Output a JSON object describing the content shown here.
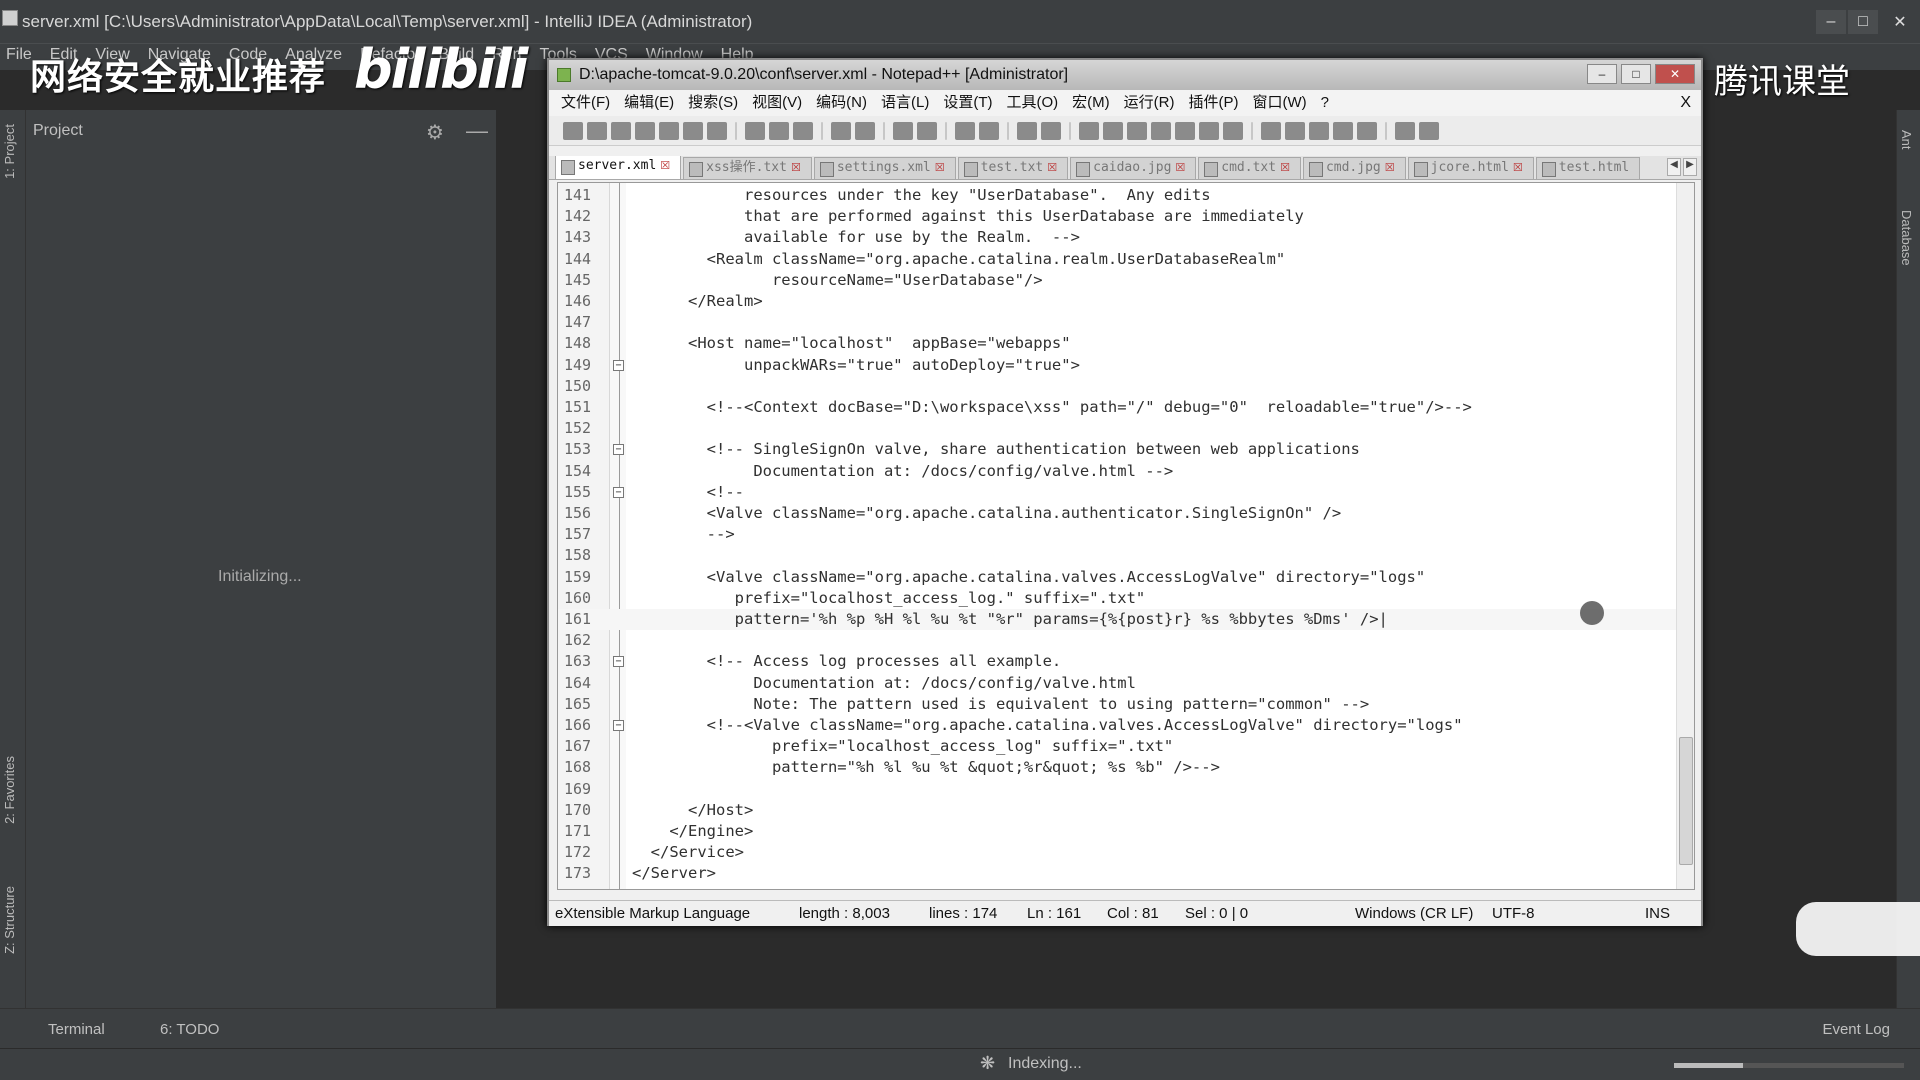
{
  "ide": {
    "title": "server.xml [C:\\Users\\Administrator\\AppData\\Local\\Temp\\server.xml] - IntelliJ IDEA (Administrator)",
    "menu": [
      "File",
      "Edit",
      "View",
      "Navigate",
      "Code",
      "Analyze",
      "Refactor",
      "Build",
      "Run",
      "Tools",
      "VCS",
      "Window",
      "Help"
    ],
    "project_panel": {
      "title": "Project",
      "status": "Initializing..."
    },
    "left_tabs": [
      "1: Project",
      "2: Favorites",
      "Z: Structure"
    ],
    "right_tabs": [
      "Ant",
      "Database"
    ],
    "bottom_tabs": {
      "terminal": "Terminal",
      "todo": "6: TODO",
      "event_log": "Event Log"
    },
    "status": {
      "indexing": "Indexing...",
      "progress": 0.3
    }
  },
  "watermarks": {
    "left": "网络安全就业推荐",
    "logo": "bilibili",
    "right": "腾讯课堂"
  },
  "npp": {
    "title": "D:\\apache-tomcat-9.0.20\\conf\\server.xml - Notepad++ [Administrator]",
    "menu": [
      "文件(F)",
      "编辑(E)",
      "搜索(S)",
      "视图(V)",
      "编码(N)",
      "语言(L)",
      "设置(T)",
      "工具(O)",
      "宏(M)",
      "运行(R)",
      "插件(P)",
      "窗口(W)",
      "?"
    ],
    "menu_close": "X",
    "tabs": [
      "server.xml",
      "xss操作.txt",
      "settings.xml",
      "test.txt",
      "caidao.jpg",
      "cmd.txt",
      "cmd.jpg",
      "jcore.html",
      "test.html"
    ],
    "active_tab": 0,
    "code_lines": [
      {
        "n": "141",
        "t": "            resources under the key \"UserDatabase\".  Any edits"
      },
      {
        "n": "142",
        "t": "            that are performed against this UserDatabase are immediately"
      },
      {
        "n": "143",
        "t": "            available for use by the Realm.  -->"
      },
      {
        "n": "144",
        "t": "        <Realm className=\"org.apache.catalina.realm.UserDatabaseRealm\""
      },
      {
        "n": "145",
        "t": "               resourceName=\"UserDatabase\"/>"
      },
      {
        "n": "146",
        "t": "      </Realm>"
      },
      {
        "n": "147",
        "t": ""
      },
      {
        "n": "148",
        "t": "      <Host name=\"localhost\"  appBase=\"webapps\""
      },
      {
        "n": "149",
        "t": "            unpackWARs=\"true\" autoDeploy=\"true\">"
      },
      {
        "n": "150",
        "t": ""
      },
      {
        "n": "151",
        "t": "        <!--<Context docBase=\"D:\\workspace\\xss\" path=\"/\" debug=\"0\"  reloadable=\"true\"/>-->"
      },
      {
        "n": "152",
        "t": ""
      },
      {
        "n": "153",
        "t": "        <!-- SingleSignOn valve, share authentication between web applications"
      },
      {
        "n": "154",
        "t": "             Documentation at: /docs/config/valve.html -->"
      },
      {
        "n": "155",
        "t": "        <!--"
      },
      {
        "n": "156",
        "t": "        <Valve className=\"org.apache.catalina.authenticator.SingleSignOn\" />"
      },
      {
        "n": "157",
        "t": "        -->"
      },
      {
        "n": "158",
        "t": ""
      },
      {
        "n": "159",
        "t": "        <Valve className=\"org.apache.catalina.valves.AccessLogValve\" directory=\"logs\""
      },
      {
        "n": "160",
        "t": "           prefix=\"localhost_access_log.\" suffix=\".txt\""
      },
      {
        "n": "161",
        "t": "           pattern='%h %p %H %l %u %t \"%r\" params={%{post}r} %s %bbytes %Dms' />|"
      },
      {
        "n": "162",
        "t": ""
      },
      {
        "n": "163",
        "t": "        <!-- Access log processes all example."
      },
      {
        "n": "164",
        "t": "             Documentation at: /docs/config/valve.html"
      },
      {
        "n": "165",
        "t": "             Note: The pattern used is equivalent to using pattern=\"common\" -->"
      },
      {
        "n": "166",
        "t": "        <!--<Valve className=\"org.apache.catalina.valves.AccessLogValve\" directory=\"logs\""
      },
      {
        "n": "167",
        "t": "               prefix=\"localhost_access_log\" suffix=\".txt\""
      },
      {
        "n": "168",
        "t": "               pattern=\"%h %l %u %t &quot;%r&quot; %s %b\" />-->"
      },
      {
        "n": "169",
        "t": ""
      },
      {
        "n": "170",
        "t": "      </Host>"
      },
      {
        "n": "171",
        "t": "    </Engine>"
      },
      {
        "n": "172",
        "t": "  </Service>"
      },
      {
        "n": "173",
        "t": "</Server>"
      }
    ],
    "fold_markers": [
      "149",
      "153",
      "155",
      "163",
      "166"
    ],
    "status": {
      "language": "eXtensible Markup Language",
      "length": "length : 8,003",
      "lines": "lines : 174",
      "ln": "Ln : 161",
      "col": "Col : 81",
      "sel": "Sel : 0 | 0",
      "eol": "Windows (CR LF)",
      "encoding": "UTF-8",
      "mode": "INS"
    }
  }
}
